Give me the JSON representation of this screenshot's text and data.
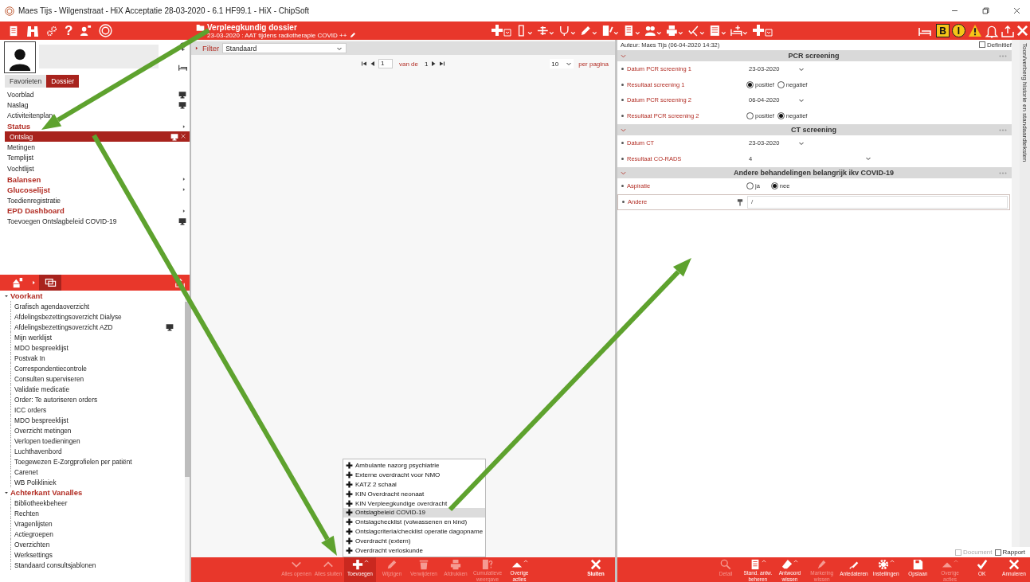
{
  "window": {
    "title": "Maes Tijs - Wilgenstraat - HiX Acceptatie  28-03-2020 - 6.1 HF99.1 - HiX - ChipSoft"
  },
  "toolbar": {
    "help_label": "?",
    "alerts": [
      {
        "letter": "B",
        "kind": "square"
      },
      {
        "letter": "I",
        "kind": "circle"
      }
    ]
  },
  "header": {
    "title": "Verpleegkundig dossier",
    "subtitle": "23-03-2020 : AAT tijdens radiotherapie COVID ++"
  },
  "sidebar": {
    "tabs": [
      {
        "label": "Favorieten",
        "selected": false
      },
      {
        "label": "Dossier",
        "selected": true
      }
    ],
    "items": [
      {
        "label": "Voorblad",
        "kind": "item",
        "selected": false,
        "screen_icon": true
      },
      {
        "label": "Naslag",
        "kind": "item",
        "selected": false,
        "screen_icon": true
      },
      {
        "label": "Activiteitenplan",
        "kind": "item",
        "selected": false,
        "screen_icon": false
      },
      {
        "label": "Status",
        "kind": "group",
        "selected": false,
        "screen_icon": false
      },
      {
        "label": "Ontslag",
        "kind": "item",
        "selected": true,
        "screen_icon": true
      },
      {
        "label": "Metingen",
        "kind": "item",
        "selected": false,
        "screen_icon": false
      },
      {
        "label": "Templijst",
        "kind": "item",
        "selected": false,
        "screen_icon": false
      },
      {
        "label": "Vochtlijst",
        "kind": "item",
        "selected": false,
        "screen_icon": false
      },
      {
        "label": "Balansen",
        "kind": "group",
        "selected": false,
        "screen_icon": false
      },
      {
        "label": "Glucoselijst",
        "kind": "group",
        "selected": false,
        "screen_icon": false
      },
      {
        "label": "Toedienregistratie",
        "kind": "item",
        "selected": false,
        "screen_icon": false
      },
      {
        "label": "EPD Dashboard",
        "kind": "group",
        "selected": false,
        "screen_icon": false
      },
      {
        "label": "Toevoegen Ontslagbeleid COVID-19",
        "kind": "item",
        "selected": false,
        "screen_icon": true
      }
    ],
    "worklists": [
      {
        "label": "Voorkant",
        "expanded": true,
        "children": [
          {
            "label": "Grafisch agendaoverzicht",
            "screen_icon": false
          },
          {
            "label": "Afdelingsbezettingsoverzicht Dialyse",
            "screen_icon": false
          },
          {
            "label": "Afdelingsbezettingsoverzicht AZD",
            "screen_icon": true
          },
          {
            "label": "Mijn werklijst",
            "screen_icon": false
          },
          {
            "label": "MDO bespreeklijst",
            "screen_icon": false
          },
          {
            "label": "Postvak In",
            "screen_icon": false
          },
          {
            "label": "Correspondentiecontrole",
            "screen_icon": false
          },
          {
            "label": "Consulten superviseren",
            "screen_icon": false
          },
          {
            "label": "Validatie medicatie",
            "screen_icon": false
          },
          {
            "label": "Order: Te autoriseren orders",
            "screen_icon": false
          },
          {
            "label": "ICC orders",
            "screen_icon": false
          },
          {
            "label": "MDO bespreeklijst",
            "screen_icon": false
          },
          {
            "label": "Overzicht metingen",
            "screen_icon": false
          },
          {
            "label": "Verlopen toedieningen",
            "screen_icon": false
          },
          {
            "label": "Luchthavenbord",
            "screen_icon": false
          },
          {
            "label": "Toegewezen E-Zorgprofielen per patiënt",
            "screen_icon": false
          },
          {
            "label": "Carenet",
            "screen_icon": false
          },
          {
            "label": "WB Polikliniek",
            "screen_icon": false
          }
        ]
      },
      {
        "label": "Achterkant Vanalles",
        "expanded": true,
        "children": [
          {
            "label": "Bibliotheekbeheer",
            "screen_icon": false
          },
          {
            "label": "Rechten",
            "screen_icon": false
          },
          {
            "label": "Vragenlijsten",
            "screen_icon": false
          },
          {
            "label": "Actiegroepen",
            "screen_icon": false
          },
          {
            "label": "Overzichten",
            "screen_icon": false
          },
          {
            "label": "Werksettings",
            "screen_icon": false
          },
          {
            "label": "Standaard consultsjablonen",
            "screen_icon": false
          }
        ]
      }
    ]
  },
  "list_view": {
    "filter": {
      "label": "Filter",
      "value": "Standaard"
    },
    "pager": {
      "page": "1",
      "of_label": "van de",
      "pages": "1",
      "per_page": "10",
      "per_page_label": "per pagina"
    },
    "add_menu": [
      {
        "label": "Ambulante nazorg psychiatrie",
        "selected": false
      },
      {
        "label": "Externe overdracht voor NMO",
        "selected": false
      },
      {
        "label": "KATZ 2 schaal",
        "selected": false
      },
      {
        "label": "KIN Overdracht neonaat",
        "selected": false
      },
      {
        "label": "KIN Verpleegkundige overdracht",
        "selected": false
      },
      {
        "label": "Ontslagbeleid COVID-19",
        "selected": true
      },
      {
        "label": "Ontslagchecklist  (volwassenen en kind)",
        "selected": false
      },
      {
        "label": "Ontslagcriteria/checklist operatie dagopname",
        "selected": false
      },
      {
        "label": "Overdracht (extern)",
        "selected": false
      },
      {
        "label": "Overdracht verloskunde",
        "selected": false
      }
    ],
    "actions": [
      {
        "label": "Alles openen",
        "disabled": true,
        "selected": false
      },
      {
        "label": "Alles sluiten",
        "disabled": true,
        "selected": false
      },
      {
        "label": "Toevoegen",
        "disabled": false,
        "selected": true
      },
      {
        "label": "Wijzigen",
        "disabled": true,
        "selected": false
      },
      {
        "label": "Verwijderen",
        "disabled": true,
        "selected": false
      },
      {
        "label": "Afdrukken",
        "disabled": true,
        "selected": false
      },
      {
        "label": "Cumulatieve weergave",
        "disabled": true,
        "selected": false
      },
      {
        "label": "Overige acties",
        "disabled": false,
        "selected": false
      }
    ],
    "close_label": "Sluiten"
  },
  "form": {
    "author": "Auteur: Maes Tijs (06-04-2020 14:32)",
    "final": {
      "label": "Definitief",
      "checked": false
    },
    "sections": [
      {
        "title": "PCR screening",
        "expanded": true,
        "rows": [
          {
            "label": "Datum PCR screening 1",
            "kind": "date",
            "value": "23-03-2020"
          },
          {
            "label": "Resultaat screening 1",
            "kind": "radio",
            "options": [
              {
                "label": "positief",
                "selected": true
              },
              {
                "label": "negatief",
                "selected": false
              }
            ]
          },
          {
            "label": "Datum PCR screening 2",
            "kind": "date",
            "value": "06-04-2020"
          },
          {
            "label": "Resultaat PCR screening 2",
            "kind": "radio",
            "options": [
              {
                "label": "positief",
                "selected": false
              },
              {
                "label": "negatief",
                "selected": true
              }
            ]
          }
        ]
      },
      {
        "title": "CT screening",
        "expanded": true,
        "rows": [
          {
            "label": "Datum CT",
            "kind": "date",
            "value": "23-03-2020"
          },
          {
            "label": "Resultaat CO-RADS",
            "kind": "select",
            "value": "4"
          }
        ]
      },
      {
        "title": "Andere behandelingen belangrijk ikv COVID-19",
        "expanded": true,
        "rows": [
          {
            "label": "Aspiratie",
            "kind": "radio",
            "options": [
              {
                "label": "ja",
                "selected": false
              },
              {
                "label": "nee",
                "selected": true
              }
            ]
          },
          {
            "label": "Andere",
            "kind": "text",
            "value": "/"
          }
        ]
      }
    ],
    "side_label": "Toon/verberg historie en standaardteksten",
    "checks": [
      {
        "label": "Document",
        "checked": false,
        "disabled": true
      },
      {
        "label": "Rapport",
        "checked": false,
        "disabled": false
      }
    ],
    "actions": [
      {
        "label": "Detail",
        "disabled": true
      },
      {
        "label": "Stand. antw. beheren",
        "disabled": false
      },
      {
        "label": "Antwoord wissen",
        "disabled": false
      },
      {
        "label": "Markering wissen",
        "disabled": true
      },
      {
        "label": "Antedateren",
        "disabled": false
      },
      {
        "label": "Instellingen",
        "disabled": false
      },
      {
        "label": "Opslaan",
        "disabled": false
      },
      {
        "label": "Overige acties",
        "disabled": true
      },
      {
        "label": "OK",
        "disabled": false
      },
      {
        "label": "Annuleren",
        "disabled": false
      }
    ]
  }
}
